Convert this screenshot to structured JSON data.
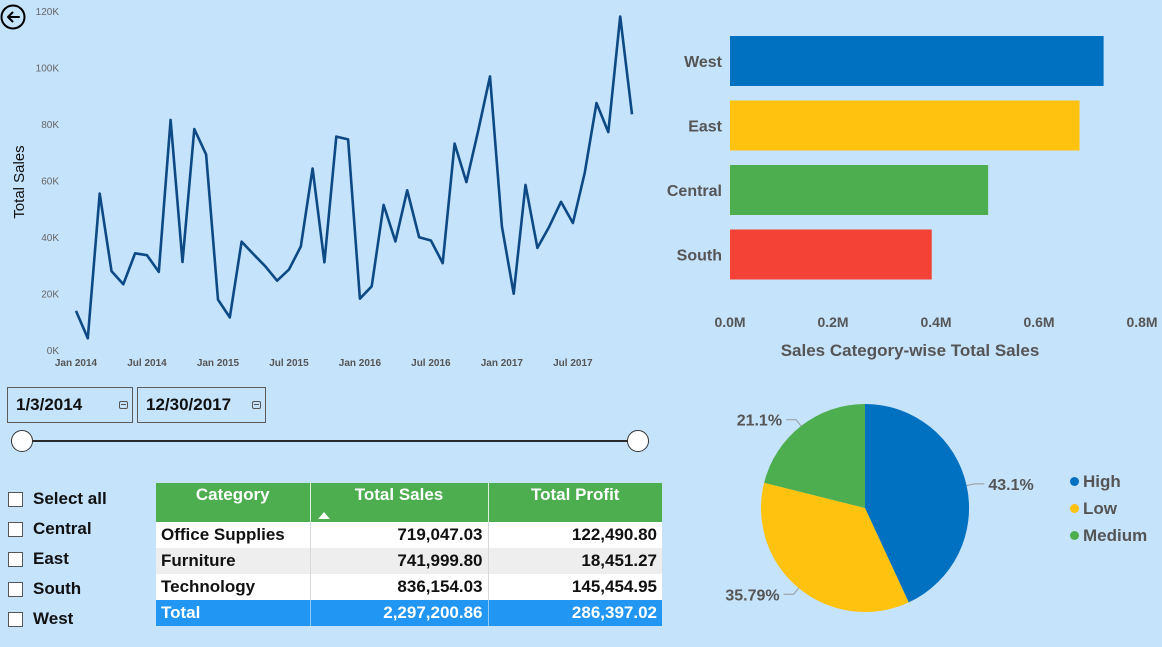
{
  "colors": {
    "background": "#c5e3fb",
    "line": "#0d4a85",
    "bar_west": "#0070c0",
    "bar_east": "#ffc20e",
    "bar_central": "#4cae4f",
    "bar_south": "#f44336",
    "table_header": "#4cae4f",
    "table_total": "#2196f3"
  },
  "icons": {
    "back": "back-arrow-circle-icon",
    "calendar": "calendar-icon"
  },
  "date_filter": {
    "start": "1/3/2014",
    "end": "12/30/2017"
  },
  "region_filter": {
    "items": [
      {
        "label": "Select all",
        "checked": false
      },
      {
        "label": "Central",
        "checked": false
      },
      {
        "label": "East",
        "checked": false
      },
      {
        "label": "South",
        "checked": false
      },
      {
        "label": "West",
        "checked": false
      }
    ]
  },
  "table": {
    "headers": [
      "Category",
      "Total Sales",
      "Total Profit"
    ],
    "sorted_column": "Total Sales",
    "rows": [
      [
        "Office Supplies",
        "719,047.03",
        "122,490.80"
      ],
      [
        "Furniture",
        "741,999.80",
        "18,451.27"
      ],
      [
        "Technology",
        "836,154.03",
        "145,454.95"
      ]
    ],
    "total": [
      "Total",
      "2,297,200.86",
      "286,397.02"
    ]
  },
  "chart_data": [
    {
      "type": "line",
      "ylabel": "Total Sales",
      "ylim": [
        0,
        120000
      ],
      "yticks": [
        "0K",
        "20K",
        "40K",
        "60K",
        "80K",
        "100K",
        "120K"
      ],
      "xticks": [
        "Jan 2014",
        "Jul 2014",
        "Jan 2015",
        "Jul 2015",
        "Jan 2016",
        "Jul 2016",
        "Jan 2017",
        "Jul 2017"
      ],
      "x_start": "2014-01",
      "x_end": "2017-12",
      "values": [
        14200,
        4500,
        55700,
        28300,
        23600,
        34600,
        33900,
        28000,
        81800,
        31500,
        78600,
        69600,
        18200,
        11900,
        38700,
        34300,
        30000,
        24900,
        28800,
        37000,
        64600,
        31400,
        75900,
        74900,
        18500,
        22900,
        51700,
        38800,
        56900,
        40300,
        39100,
        31100,
        73400,
        59800,
        78000,
        97200,
        44100,
        20300,
        58800,
        36500,
        44000,
        52800,
        45300,
        63000,
        87800,
        77500,
        118400,
        83800
      ],
      "grid": false
    },
    {
      "type": "bar",
      "orientation": "horizontal",
      "title": "Sales Category-wise Total Sales",
      "categories": [
        "West",
        "East",
        "Central",
        "South"
      ],
      "values": [
        725458,
        678781,
        501240,
        391722
      ],
      "xticks": [
        "0.0M",
        "0.2M",
        "0.4M",
        "0.6M",
        "0.8M"
      ],
      "xlim": [
        0,
        0.8
      ],
      "grid": false
    },
    {
      "type": "pie",
      "labels": [
        "High",
        "Low",
        "Medium"
      ],
      "values": [
        43.1,
        35.79,
        21.1
      ],
      "data_labels": [
        "43.1%",
        "35.79%",
        "21.1%"
      ],
      "colors": [
        "#0070c0",
        "#ffc20e",
        "#4cae4f"
      ],
      "legend": "right"
    }
  ]
}
